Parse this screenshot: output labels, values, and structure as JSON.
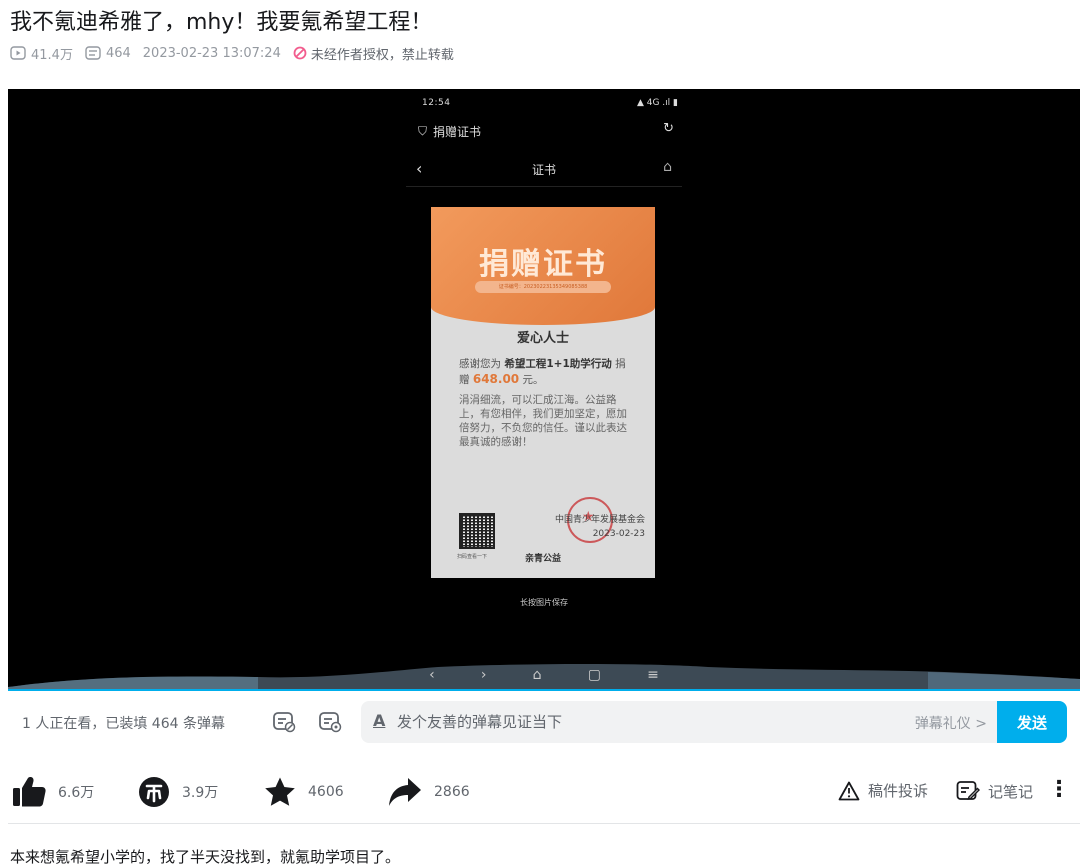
{
  "video": {
    "title": "我不氪迪希雅了，mhy！我要氪希望工程！",
    "views": "41.4万",
    "danmaku_count": "464",
    "publish_time": "2023-02-23 13:07:24",
    "copyright_notice": "未经作者授权，禁止转载"
  },
  "player": {
    "phone_status_time": "12:54",
    "phone_status_right": "▲ 4G .ıl ▮",
    "mini_program_title": "捐赠证书",
    "nav_title": "证书",
    "certificate": {
      "heading": "捐赠证书",
      "cert_number": "证书编号：20230223135349085388",
      "recipient": "爱心人士",
      "thanks_prefix": "感谢您为",
      "program": "希望工程1+1助学行动",
      "donate_word": "捐赠",
      "amount": "648.00",
      "amount_unit": "元。",
      "message": "涓涓细流，可以汇成江海。公益路上，有您相伴，我们更加坚定，愿加倍努力，不负您的信任。谨以此表达最真诚的感谢！",
      "organization": "中国青少年发展基金会",
      "date": "2023-02-23",
      "qr_caption": "扫码查看一下",
      "brand": "亲青公益"
    },
    "save_hint": "长按图片保存"
  },
  "danmaku_bar": {
    "status": "1 人正在看，已装填 464 条弹幕",
    "input_placeholder": "发个友善的弹幕见证当下",
    "etiquette": "弹幕礼仪 >",
    "send": "发送"
  },
  "toolbar": {
    "like": "6.6万",
    "coin": "3.9万",
    "favorite": "4606",
    "share": "2866",
    "report": "稿件投诉",
    "notes": "记笔记"
  },
  "description": "本来想氪希望小学的，找了半天没找到，就氪助学项目了。",
  "colors": {
    "accent": "#00aeec",
    "icon_dark": "#18191c",
    "text_gray": "#61666d"
  }
}
